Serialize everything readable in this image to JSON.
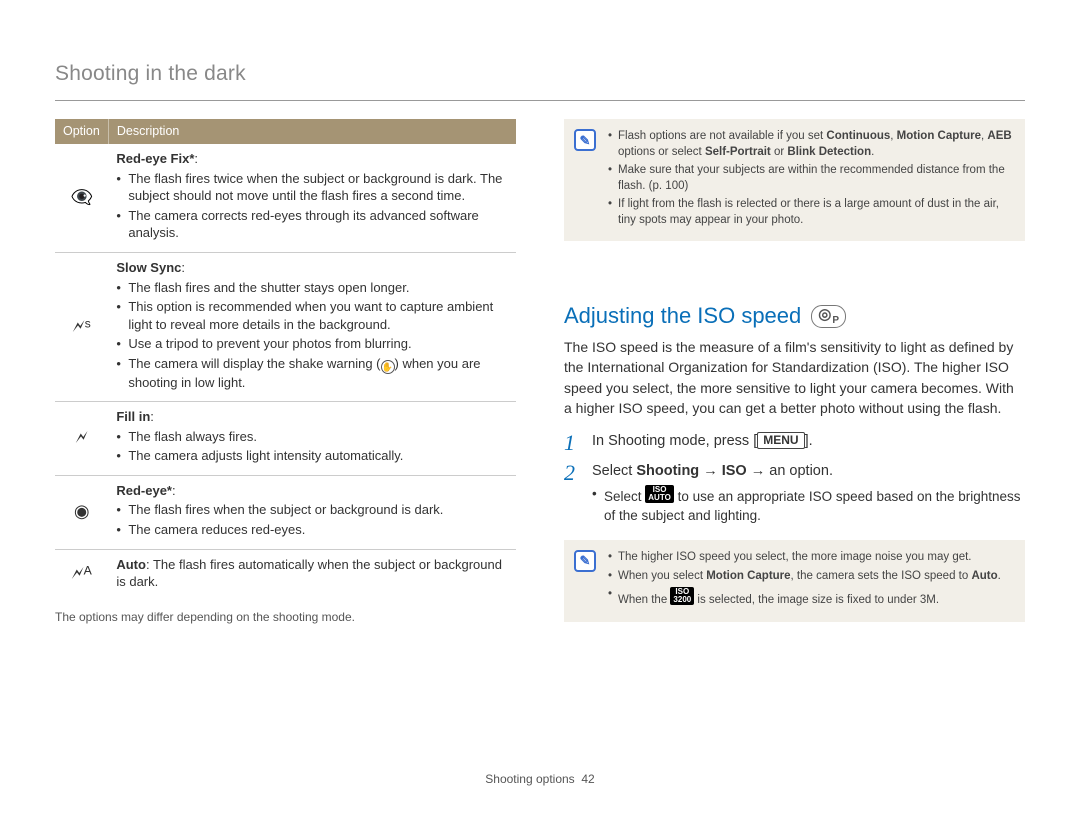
{
  "header": {
    "title": "Shooting in the dark"
  },
  "options_table": {
    "columns": {
      "option": "Option",
      "description": "Description"
    },
    "rows": [
      {
        "icon": "👁‍🗨",
        "icon_name": "red-eye-fix-icon",
        "title": "Red-eye Fix*",
        "bullets": [
          "The flash fires twice when the subject or background is dark. The subject should not move until the flash fires a second time.",
          "The camera corrects red-eyes through its advanced software analysis."
        ]
      },
      {
        "icon": "🗲ˢ",
        "icon_name": "slow-sync-icon",
        "title": "Slow Sync",
        "bullets": [
          "The flash fires and the shutter stays open longer.",
          "This option is recommended when you want to capture ambient light to reveal more details in the background.",
          "Use a tripod to prevent your photos from blurring.",
          "The camera will display the shake warning (✋) when you are shooting in low light."
        ]
      },
      {
        "icon": "🗲",
        "icon_name": "fill-in-icon",
        "title": "Fill in",
        "bullets": [
          "The flash always fires.",
          "The camera adjusts light intensity automatically."
        ]
      },
      {
        "icon": "◉",
        "icon_name": "red-eye-icon",
        "title": "Red-eye*",
        "bullets": [
          "The flash fires when the subject or background is dark.",
          "The camera reduces red-eyes."
        ]
      },
      {
        "icon": "🗲ᴬ",
        "icon_name": "auto-flash-icon",
        "title": "Auto",
        "title_after": ": The flash fires automatically when the subject or background is dark."
      }
    ],
    "footnote": "The options may differ depending on the shooting mode."
  },
  "right": {
    "top_note": {
      "bullets_html": [
        "Flash options are not available if you set <b>Continuous</b>, <b>Motion Capture</b>, <b>AEB</b> options or select <b>Self-Portrait</b> or <b>Blink Detection</b>.",
        "Make sure that your subjects are within the recommended distance from the flash. (p. 100)",
        "If light from the flash is relected or there is a large amount of dust in the air, tiny spots may appear in your photo."
      ]
    },
    "heading": "Adjusting the ISO speed",
    "body": "The ISO speed is the measure of a film's sensitivity to light as defined by the International Organization for Standardization (ISO). The higher ISO speed you select, the more sensitive to light your camera becomes. With a higher ISO speed, you can get a better photo without using the flash.",
    "steps": {
      "step1_pre": "In Shooting mode, press [",
      "step1_btn": "MENU",
      "step1_post": "].",
      "step2_html": "Select <b>Shooting</b> → <b>ISO</b> → an option.",
      "step2_bullet_pre": "Select ",
      "step2_bullet_icon": "ISO\nAUTO",
      "step2_bullet_post": " to use an appropriate ISO speed based on the brightness of the subject and lighting."
    },
    "bottom_note": {
      "bullets": {
        "b0": "The higher ISO speed you select, the more image noise you may get.",
        "b1_pre": "When you select ",
        "b1_bold": "Motion Capture",
        "b1_mid": ", the camera sets the ISO speed to ",
        "b1_bold2": "Auto",
        "b1_post": ".",
        "b2_pre": "When the ",
        "b2_icon": "ISO\n3200",
        "b2_post": " is selected, the image size is fixed to under 3M."
      }
    }
  },
  "footer": {
    "section": "Shooting options",
    "page": "42"
  }
}
